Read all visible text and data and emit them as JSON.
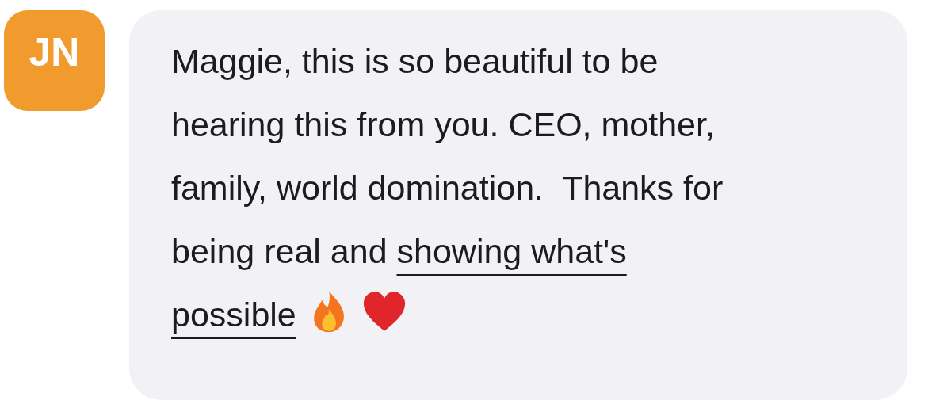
{
  "message": {
    "avatar": {
      "initials": "JN",
      "color": "#f19a2e"
    },
    "text_before": "Maggie, this is so beautiful to be\nhearing this from you. CEO, mother,\nfamily, world domination.  Thanks for\nbeing real and ",
    "underlined": "showing what's\npossible",
    "underlined_mark": true
  }
}
